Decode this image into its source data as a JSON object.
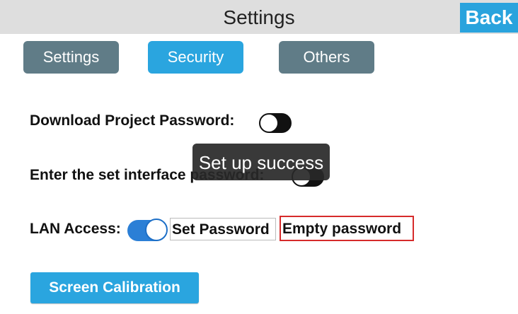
{
  "header": {
    "title": "Settings",
    "back_label": "Back"
  },
  "tabs": [
    {
      "label": "Settings",
      "active": false
    },
    {
      "label": "Security",
      "active": true
    },
    {
      "label": "Others",
      "active": false
    }
  ],
  "security": {
    "download_password_label": "Download Project Password:",
    "download_password_enabled": false,
    "interface_password_label": "Enter the set interface password:",
    "interface_password_enabled": false,
    "lan_access_label": "LAN Access:",
    "lan_access_enabled": true,
    "set_password_label": "Set Password",
    "empty_password_label": "Empty password"
  },
  "calibration_label": "Screen Calibration",
  "toast": {
    "message": "Set up success"
  },
  "colors": {
    "accent": "#2aa5df",
    "tab_inactive": "#607c87",
    "toggle_on": "#2b7fd6",
    "highlight_border": "#d62b2b"
  }
}
